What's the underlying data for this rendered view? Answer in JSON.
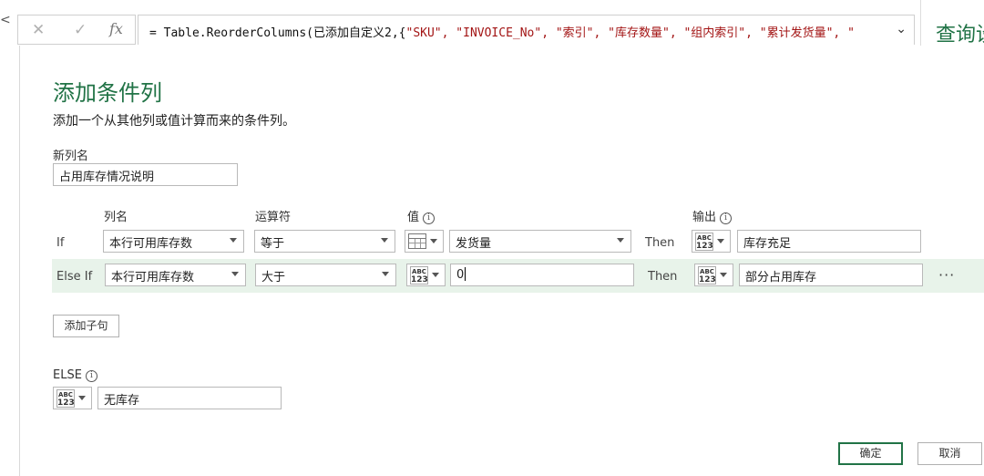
{
  "formula_bar": {
    "cancel_glyph": "✕",
    "confirm_glyph": "✓",
    "fx_label": "fx",
    "formula_prefix": "= Table.ReorderColumns(已添加自定义2,{",
    "formula_items": "\"SKU\", \"INVOICE_No\", \"索引\", \"库存数量\", \"组内索引\", \"累计发货量\", \"",
    "expand_icon": "chevron-down-icon"
  },
  "right_panel": {
    "text": "查询设"
  },
  "dialog": {
    "title": "添加条件列",
    "description": "添加一个从其他列或值计算而来的条件列。",
    "new_column_label": "新列名",
    "new_column_value": "占用库存情况说明",
    "headers": {
      "column": "列名",
      "operator": "运算符",
      "value": "值",
      "output": "输出"
    },
    "then_label": "Then",
    "rows": [
      {
        "type": "If",
        "column": "本行可用库存数",
        "operator": "等于",
        "value_type": "column",
        "value": "发货量",
        "output_type": "ABC 123",
        "output": "库存充足"
      },
      {
        "type": "Else If",
        "column": "本行可用库存数",
        "operator": "大于",
        "value_type": "ABC 123",
        "value": "0",
        "output_type": "ABC 123",
        "output": "部分占用库存"
      }
    ],
    "more_label": "···",
    "add_clause_label": "添加子句",
    "else_label": "ELSE",
    "else_value": "无库存",
    "ok_label": "确定",
    "cancel_label": "取消"
  },
  "colors": {
    "accent": "#217346",
    "row_highlight": "#e8f3ea",
    "string_literal": "#a31515"
  }
}
